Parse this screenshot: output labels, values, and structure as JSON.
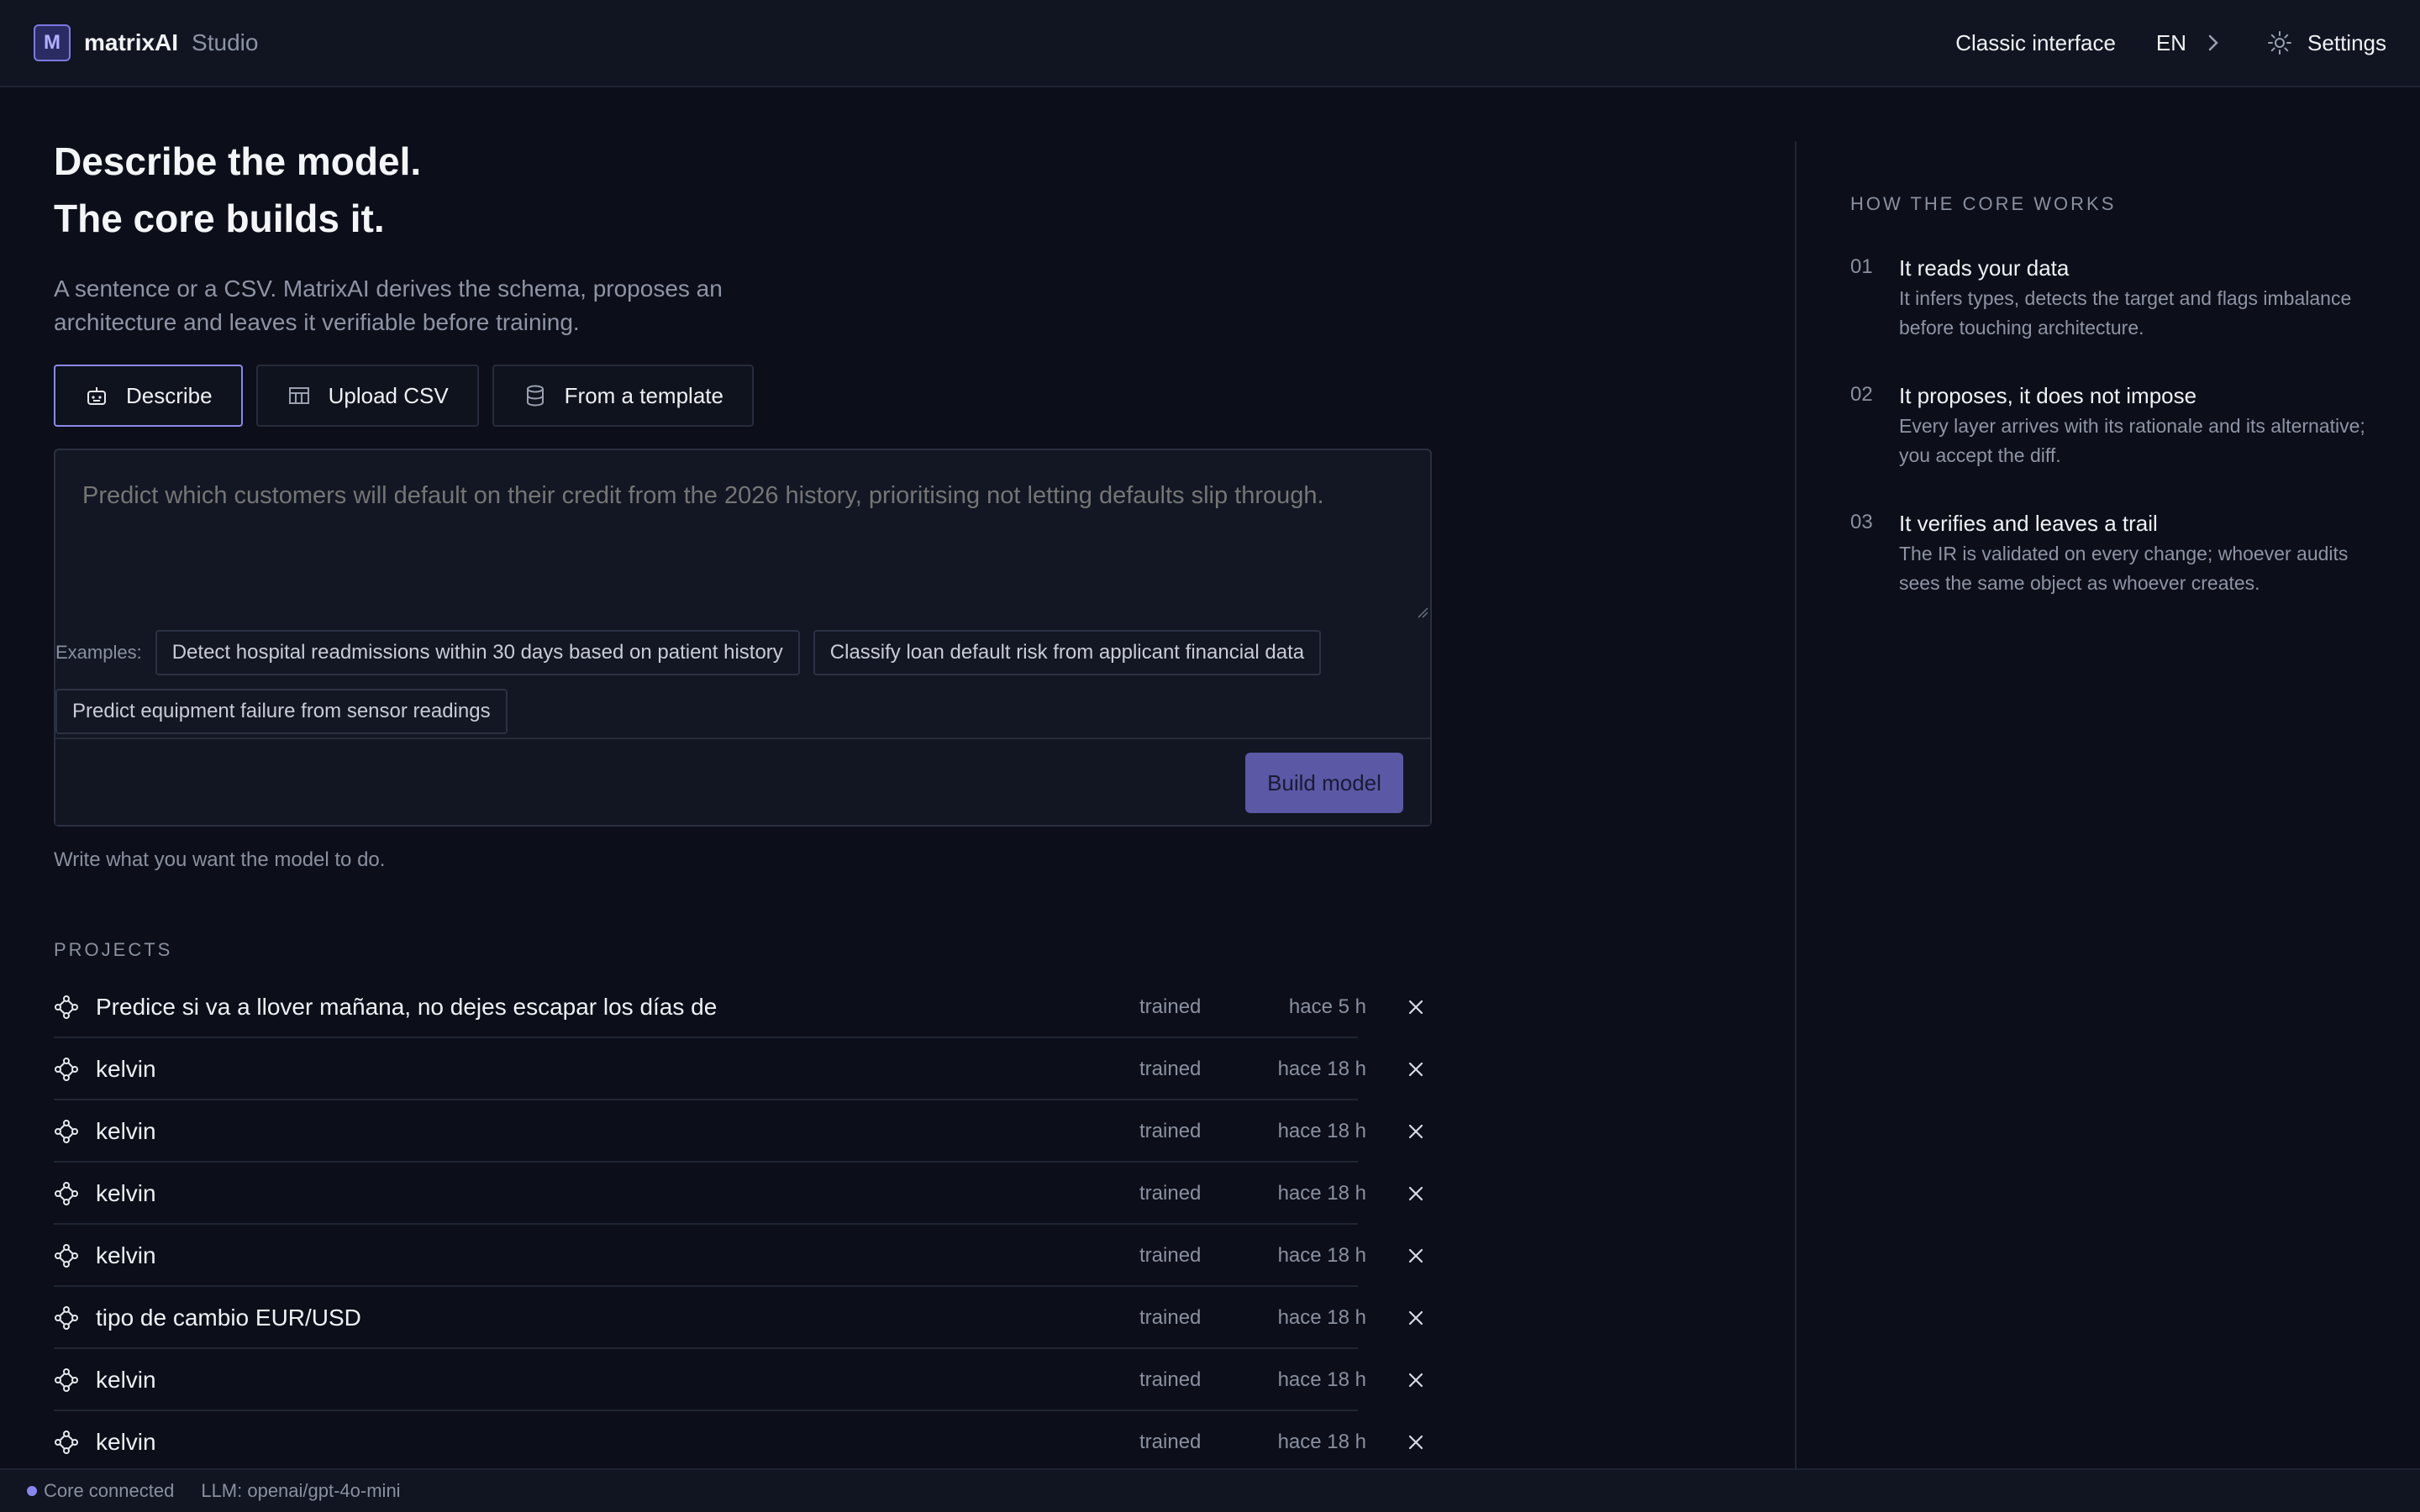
{
  "header": {
    "logo_letter": "M",
    "brand": "matrixAI",
    "brand_sub": "Studio",
    "classic_interface": "Classic interface",
    "language": "EN",
    "settings": "Settings"
  },
  "hero": {
    "title_line1": "Describe the model.",
    "title_line2": "The core builds it.",
    "subtitle": "A sentence or a CSV. MatrixAI derives the schema, proposes an architecture and leaves it verifiable before training."
  },
  "modes": [
    {
      "label": "Describe",
      "icon": "robot-icon",
      "active": true
    },
    {
      "label": "Upload CSV",
      "icon": "table-icon",
      "active": false
    },
    {
      "label": "From a template",
      "icon": "database-icon",
      "active": false
    }
  ],
  "composer": {
    "placeholder": "Predict which customers will default on their credit from the 2026 history, prioritising not letting defaults slip through.",
    "examples_label": "Examples:",
    "examples": [
      "Detect hospital readmissions within 30 days based on patient history",
      "Classify loan default risk from applicant financial data",
      "Predict equipment failure from sensor readings"
    ],
    "build_button": "Build model",
    "hint": "Write what you want the model to do."
  },
  "projects": {
    "label": "PROJECTS",
    "rows": [
      {
        "name": "Predice si va a llover mañana, no dejes escapar los días de",
        "status": "trained",
        "time": "hace 5 h"
      },
      {
        "name": "kelvin",
        "status": "trained",
        "time": "hace 18 h"
      },
      {
        "name": "kelvin",
        "status": "trained",
        "time": "hace 18 h"
      },
      {
        "name": "kelvin",
        "status": "trained",
        "time": "hace 18 h"
      },
      {
        "name": "kelvin",
        "status": "trained",
        "time": "hace 18 h"
      },
      {
        "name": "tipo de cambio EUR/USD",
        "status": "trained",
        "time": "hace 18 h"
      },
      {
        "name": "kelvin",
        "status": "trained",
        "time": "hace 18 h"
      },
      {
        "name": "kelvin",
        "status": "trained",
        "time": "hace 18 h"
      }
    ]
  },
  "how": {
    "label": "HOW THE CORE WORKS",
    "steps": [
      {
        "num": "01",
        "title": "It reads your data",
        "text": "It infers types, detects the target and flags imbalance before touching architecture."
      },
      {
        "num": "02",
        "title": "It proposes, it does not impose",
        "text": "Every layer arrives with its rationale and its alternative; you accept the diff."
      },
      {
        "num": "03",
        "title": "It verifies and leaves a trail",
        "text": "The IR is validated on every change; whoever audits sees the same object as whoever creates."
      }
    ]
  },
  "status": {
    "connection": "Core connected",
    "llm": "LLM: openai/gpt-4o-mini"
  },
  "colors": {
    "accent": "#8c88ee",
    "background": "#0c0f19",
    "button": "#5b58a6"
  }
}
